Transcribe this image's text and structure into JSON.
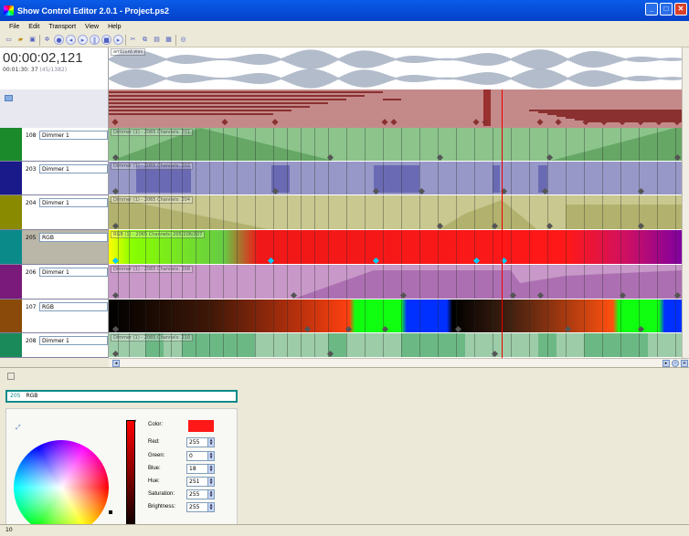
{
  "window": {
    "title": "Show Control Editor 2.0.1 - Project.ps2"
  },
  "menu": [
    "File",
    "Edit",
    "Transport",
    "View",
    "Help"
  ],
  "toolbar_icons": [
    "new-icon",
    "open-icon",
    "save-icon",
    "settings-icon",
    "record-icon",
    "rewind-icon",
    "play-icon",
    "pause-icon",
    "stop-icon",
    "forward-icon",
    "cut-icon",
    "copy-icon",
    "paste-icon",
    "grid-icon"
  ],
  "time": {
    "current": "00:00:02,121",
    "detail": "00:01:30: 37",
    "frames": "(45/1382)"
  },
  "tracks": [
    {
      "num": "108",
      "name": "Dimmer 1",
      "label": "Dimmer (1) - 2065 Channels: 201",
      "color": "#1a8a2a",
      "bg": "#8cc48c"
    },
    {
      "num": "203",
      "name": "Dimmer 1",
      "label": "Dimmer (1) - 2065 Channels: 202",
      "color": "#1a1a8a",
      "bg": "#9898c8"
    },
    {
      "num": "204",
      "name": "Dimmer 1",
      "label": "Dimmer (1) - 2065 Channels: 204",
      "color": "#8a8a00",
      "bg": "#c8c890"
    },
    {
      "num": "205",
      "name": "RGB",
      "label": "RGB (1) - 2065 Channels: 205/206/207",
      "color": "#0b8a8a",
      "bg": "#ff1818"
    },
    {
      "num": "206",
      "name": "Dimmer 1",
      "label": "Dimmer (1) - 2065 Channels: 208",
      "color": "#7a1a7a",
      "bg": "#c898c8"
    },
    {
      "num": "107",
      "name": "RGB",
      "label": "",
      "color": "#8a4a0a",
      "bg": "#101010"
    },
    {
      "num": "208",
      "name": "Dimmer 1",
      "label": "Dimmer (1) - 2065 Channels: 210",
      "color": "#1a8a5a",
      "bg": "#9ccca8"
    }
  ],
  "selected": {
    "num": "205",
    "name": "RGB"
  },
  "color_props": [
    {
      "label": "Color:",
      "value": ""
    },
    {
      "label": "Red:",
      "value": "255"
    },
    {
      "label": "Green:",
      "value": "0"
    },
    {
      "label": "Blue:",
      "value": "18"
    },
    {
      "label": "Hue:",
      "value": "251"
    },
    {
      "label": "Saturation:",
      "value": "255"
    },
    {
      "label": "Brightness:",
      "value": "255"
    }
  ],
  "colors": {
    "selected_color": "#ff1818",
    "accent": "#0b8a8a"
  },
  "audio_label": "ambient.wav",
  "status": "10"
}
